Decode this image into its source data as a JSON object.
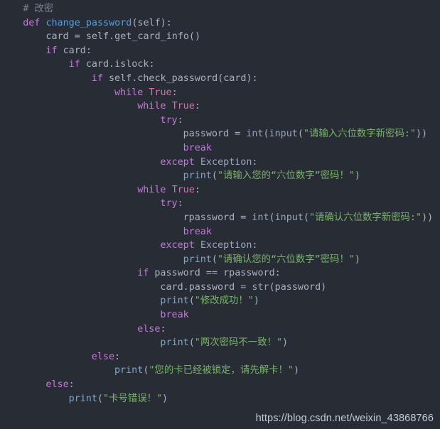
{
  "editor": {
    "background_color": "#282c34",
    "language": "python",
    "theme_colors": {
      "comment": "#7a818e",
      "keyword": "#c678dd",
      "constant": "#d36fb4",
      "function_name": "#5c9ddb",
      "builtin": "#9aa7bb",
      "print": "#7fa6cc",
      "string": "#79b36b",
      "plain": "#a9b1c0"
    },
    "lines": [
      {
        "indent": 1,
        "tokens": [
          {
            "t": "comment",
            "v": "# 改密"
          }
        ]
      },
      {
        "indent": 1,
        "tokens": [
          {
            "t": "keyword",
            "v": "def"
          },
          {
            "t": "plain",
            "v": " "
          },
          {
            "t": "func",
            "v": "change_password"
          },
          {
            "t": "plain",
            "v": "(self):"
          }
        ]
      },
      {
        "indent": 2,
        "tokens": [
          {
            "t": "plain",
            "v": "card = self.get_card_info()"
          }
        ]
      },
      {
        "indent": 2,
        "tokens": [
          {
            "t": "keyword",
            "v": "if"
          },
          {
            "t": "plain",
            "v": " card:"
          }
        ]
      },
      {
        "indent": 3,
        "tokens": [
          {
            "t": "keyword",
            "v": "if"
          },
          {
            "t": "plain",
            "v": " card.islock:"
          }
        ]
      },
      {
        "indent": 4,
        "tokens": [
          {
            "t": "keyword",
            "v": "if"
          },
          {
            "t": "plain",
            "v": " self.check_password(card):"
          }
        ]
      },
      {
        "indent": 5,
        "tokens": [
          {
            "t": "keyword",
            "v": "while"
          },
          {
            "t": "plain",
            "v": " "
          },
          {
            "t": "const",
            "v": "True"
          },
          {
            "t": "plain",
            "v": ":"
          }
        ]
      },
      {
        "indent": 6,
        "tokens": [
          {
            "t": "keyword",
            "v": "while"
          },
          {
            "t": "plain",
            "v": " "
          },
          {
            "t": "const",
            "v": "True"
          },
          {
            "t": "plain",
            "v": ":"
          }
        ]
      },
      {
        "indent": 7,
        "tokens": [
          {
            "t": "keyword",
            "v": "try"
          },
          {
            "t": "plain",
            "v": ":"
          }
        ]
      },
      {
        "indent": 8,
        "tokens": [
          {
            "t": "plain",
            "v": "password = "
          },
          {
            "t": "builtin",
            "v": "int"
          },
          {
            "t": "plain",
            "v": "("
          },
          {
            "t": "builtin",
            "v": "input"
          },
          {
            "t": "plain",
            "v": "("
          },
          {
            "t": "string",
            "v": "\"请输入六位数字新密码:\""
          },
          {
            "t": "plain",
            "v": "))"
          }
        ]
      },
      {
        "indent": 8,
        "tokens": [
          {
            "t": "kw2",
            "v": "break"
          }
        ]
      },
      {
        "indent": 7,
        "tokens": [
          {
            "t": "keyword",
            "v": "except"
          },
          {
            "t": "plain",
            "v": " "
          },
          {
            "t": "builtin",
            "v": "Exception"
          },
          {
            "t": "plain",
            "v": ":"
          }
        ]
      },
      {
        "indent": 8,
        "tokens": [
          {
            "t": "print",
            "v": "print"
          },
          {
            "t": "plain",
            "v": "("
          },
          {
            "t": "string",
            "v": "\"请输入您的“六位数字”密码！\""
          },
          {
            "t": "plain",
            "v": ")"
          }
        ]
      },
      {
        "indent": 6,
        "tokens": [
          {
            "t": "keyword",
            "v": "while"
          },
          {
            "t": "plain",
            "v": " "
          },
          {
            "t": "const",
            "v": "True"
          },
          {
            "t": "plain",
            "v": ":"
          }
        ]
      },
      {
        "indent": 7,
        "tokens": [
          {
            "t": "keyword",
            "v": "try"
          },
          {
            "t": "plain",
            "v": ":"
          }
        ]
      },
      {
        "indent": 8,
        "tokens": [
          {
            "t": "plain",
            "v": "rpassword = "
          },
          {
            "t": "builtin",
            "v": "int"
          },
          {
            "t": "plain",
            "v": "("
          },
          {
            "t": "builtin",
            "v": "input"
          },
          {
            "t": "plain",
            "v": "("
          },
          {
            "t": "string",
            "v": "\"请确认六位数字新密码:\""
          },
          {
            "t": "plain",
            "v": "))"
          }
        ]
      },
      {
        "indent": 8,
        "tokens": [
          {
            "t": "kw2",
            "v": "break"
          }
        ]
      },
      {
        "indent": 7,
        "tokens": [
          {
            "t": "keyword",
            "v": "except"
          },
          {
            "t": "plain",
            "v": " "
          },
          {
            "t": "builtin",
            "v": "Exception"
          },
          {
            "t": "plain",
            "v": ":"
          }
        ]
      },
      {
        "indent": 8,
        "tokens": [
          {
            "t": "print",
            "v": "print"
          },
          {
            "t": "plain",
            "v": "("
          },
          {
            "t": "string",
            "v": "\"请确认您的“六位数字”密码！\""
          },
          {
            "t": "plain",
            "v": ")"
          }
        ]
      },
      {
        "indent": 6,
        "tokens": [
          {
            "t": "keyword",
            "v": "if"
          },
          {
            "t": "plain",
            "v": " password == rpassword:"
          }
        ]
      },
      {
        "indent": 7,
        "tokens": [
          {
            "t": "plain",
            "v": "card.password = "
          },
          {
            "t": "builtin",
            "v": "str"
          },
          {
            "t": "plain",
            "v": "(password)"
          }
        ]
      },
      {
        "indent": 7,
        "tokens": [
          {
            "t": "print",
            "v": "print"
          },
          {
            "t": "plain",
            "v": "("
          },
          {
            "t": "string",
            "v": "\"修改成功！\""
          },
          {
            "t": "plain",
            "v": ")"
          }
        ]
      },
      {
        "indent": 7,
        "tokens": [
          {
            "t": "kw2",
            "v": "break"
          }
        ]
      },
      {
        "indent": 6,
        "tokens": [
          {
            "t": "keyword",
            "v": "else"
          },
          {
            "t": "plain",
            "v": ":"
          }
        ]
      },
      {
        "indent": 7,
        "tokens": [
          {
            "t": "print",
            "v": "print"
          },
          {
            "t": "plain",
            "v": "("
          },
          {
            "t": "string",
            "v": "\"两次密码不一致！\""
          },
          {
            "t": "plain",
            "v": ")"
          }
        ]
      },
      {
        "indent": 4,
        "tokens": [
          {
            "t": "keyword",
            "v": "else"
          },
          {
            "t": "plain",
            "v": ":"
          }
        ]
      },
      {
        "indent": 5,
        "tokens": [
          {
            "t": "print",
            "v": "print"
          },
          {
            "t": "plain",
            "v": "("
          },
          {
            "t": "string",
            "v": "\"您的卡已经被锁定，请先解卡！\""
          },
          {
            "t": "plain",
            "v": ")"
          }
        ]
      },
      {
        "indent": 2,
        "tokens": [
          {
            "t": "keyword",
            "v": "else"
          },
          {
            "t": "plain",
            "v": ":"
          }
        ]
      },
      {
        "indent": 3,
        "tokens": [
          {
            "t": "print",
            "v": "print"
          },
          {
            "t": "plain",
            "v": "("
          },
          {
            "t": "string",
            "v": "\"卡号错误！\""
          },
          {
            "t": "plain",
            "v": ")"
          }
        ]
      }
    ]
  },
  "watermark": {
    "text": "https://blog.csdn.net/weixin_43868766"
  }
}
